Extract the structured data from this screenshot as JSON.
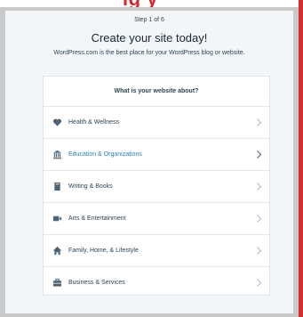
{
  "step_text": "Step 1 of 6",
  "title": "Create your site today!",
  "subtitle": "WordPress.com is the best place for your WordPress blog or website.",
  "card": {
    "question": "What is your website about?",
    "items": [
      {
        "label": "Health & Wellness",
        "icon": "heart-icon"
      },
      {
        "label": "Education & Organizations",
        "icon": "building-icon",
        "highlighted": true
      },
      {
        "label": "Writing & Books",
        "icon": "book-icon"
      },
      {
        "label": "Arts & Entertainment",
        "icon": "video-camera-icon"
      },
      {
        "label": "Family, Home, & Lifestyle",
        "icon": "house-icon"
      },
      {
        "label": "Business & Services",
        "icon": "briefcase-icon"
      }
    ]
  },
  "colors": {
    "accent": "#2b81b6",
    "text": "#2e4453",
    "icon": "#4f6475",
    "panel_bg": "#f3f6f8",
    "brand_red": "#d32f2f"
  }
}
